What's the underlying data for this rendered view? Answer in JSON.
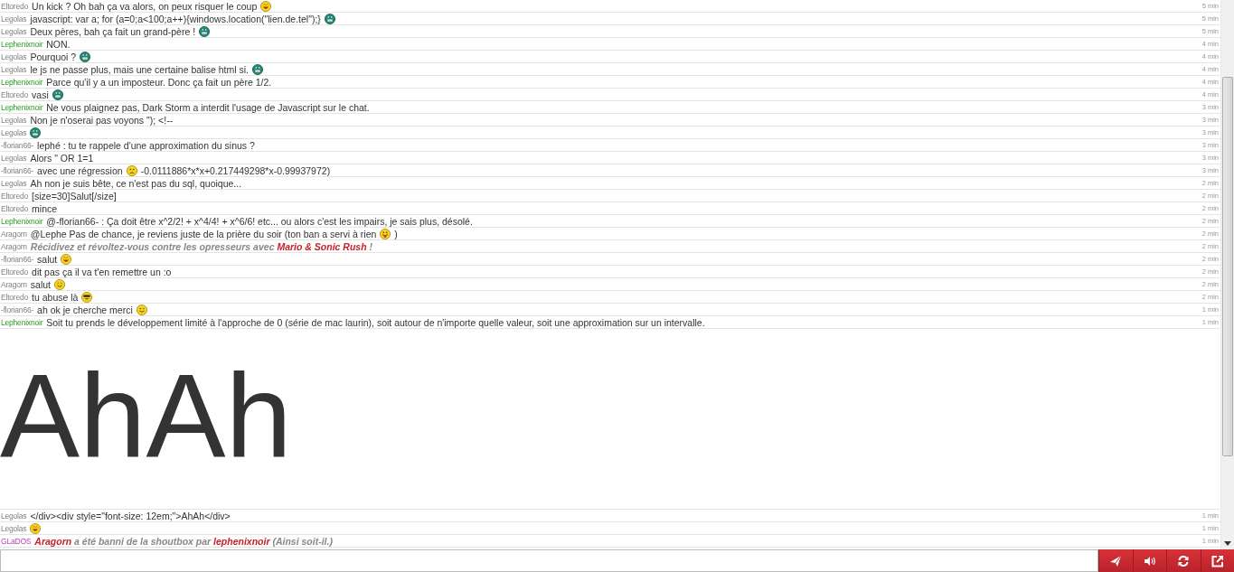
{
  "messages": [
    {
      "kind": "message",
      "author": {
        "name": "Eltoredo",
        "kind": "member"
      },
      "time": "5 min",
      "parts": [
        {
          "kind": "text",
          "text": "Un kick ? Oh bah ça va alors, on peux risquer le coup"
        },
        {
          "kind": "smiley",
          "icon": {
            "kind": "laugh"
          }
        }
      ]
    },
    {
      "kind": "message",
      "author": {
        "name": "Legolas",
        "kind": "member"
      },
      "time": "5 min",
      "parts": [
        {
          "kind": "text",
          "text": "javascript: var a; for (a=0;a<100;a++){windows.location(\"lien.de.tel\");}"
        },
        {
          "kind": "smiley",
          "icon": {
            "kind": "grin"
          }
        }
      ]
    },
    {
      "kind": "message",
      "author": {
        "name": "Legolas",
        "kind": "member"
      },
      "time": "5 min",
      "parts": [
        {
          "kind": "text",
          "text": "Deux pères, bah ça fait un grand-père !"
        },
        {
          "kind": "smiley",
          "icon": {
            "kind": "grin"
          }
        }
      ]
    },
    {
      "kind": "message",
      "author": {
        "name": "Lephenixnoir",
        "kind": "moderator"
      },
      "time": "4 min",
      "parts": [
        {
          "kind": "text",
          "text": "NON."
        }
      ]
    },
    {
      "kind": "message",
      "author": {
        "name": "Legolas",
        "kind": "member"
      },
      "time": "4 min",
      "parts": [
        {
          "kind": "text",
          "text": "Pourquoi ?"
        },
        {
          "kind": "smiley",
          "icon": {
            "kind": "grin"
          }
        }
      ]
    },
    {
      "kind": "message",
      "author": {
        "name": "Legolas",
        "kind": "member"
      },
      "time": "4 min",
      "parts": [
        {
          "kind": "text",
          "text": "le js ne passe plus, mais une certaine balise html si."
        },
        {
          "kind": "smiley",
          "icon": {
            "kind": "grin"
          }
        }
      ]
    },
    {
      "kind": "message",
      "author": {
        "name": "Lephenixnoir",
        "kind": "moderator"
      },
      "time": "4 min",
      "parts": [
        {
          "kind": "text",
          "text": "Parce qu'il y a un imposteur. Donc ça fait un père 1/2."
        }
      ]
    },
    {
      "kind": "message",
      "author": {
        "name": "Eltoredo",
        "kind": "member"
      },
      "time": "4 min",
      "parts": [
        {
          "kind": "text",
          "text": "vasi"
        },
        {
          "kind": "smiley",
          "icon": {
            "kind": "grin"
          }
        }
      ]
    },
    {
      "kind": "message",
      "author": {
        "name": "Lephenixnoir",
        "kind": "moderator"
      },
      "time": "3 min",
      "parts": [
        {
          "kind": "text",
          "text": "Ne vous plaignez pas, Dark Storm a interdit l'usage de Javascript sur le chat."
        }
      ]
    },
    {
      "kind": "message",
      "author": {
        "name": "Legolas",
        "kind": "member"
      },
      "time": "3 min",
      "parts": [
        {
          "kind": "text",
          "text": "Non je n'oserai pas voyons \"); <!--"
        }
      ]
    },
    {
      "kind": "message",
      "author": {
        "name": "Legolas",
        "kind": "member"
      },
      "time": "3 min",
      "parts": [
        {
          "kind": "smiley",
          "icon": {
            "kind": "grin"
          }
        }
      ]
    },
    {
      "kind": "message",
      "author": {
        "name": "-florian66-",
        "kind": "member"
      },
      "time": "3 min",
      "parts": [
        {
          "kind": "text",
          "text": "lephé : tu te rappele d'une approximation du sinus ?"
        }
      ]
    },
    {
      "kind": "message",
      "author": {
        "name": "Legolas",
        "kind": "member"
      },
      "time": "3 min",
      "parts": [
        {
          "kind": "text",
          "text": "Alors \" OR 1=1"
        }
      ]
    },
    {
      "kind": "message",
      "author": {
        "name": "-florian66-",
        "kind": "member"
      },
      "time": "3 min",
      "parts": [
        {
          "kind": "text",
          "text": "avec une régression"
        },
        {
          "kind": "smiley",
          "icon": {
            "kind": "sad"
          }
        },
        {
          "kind": "text",
          "text": "-0.0111886*x*x+0.217449298*x-0.99937972)"
        }
      ]
    },
    {
      "kind": "message",
      "author": {
        "name": "Legolas",
        "kind": "member"
      },
      "time": "2 min",
      "parts": [
        {
          "kind": "text",
          "text": "Ah non je suis bête, ce n'est pas du sql, quoique..."
        }
      ]
    },
    {
      "kind": "message",
      "author": {
        "name": "Eltoredo",
        "kind": "member"
      },
      "time": "2 min",
      "parts": [
        {
          "kind": "text",
          "text": "[size=30]Salut[/size]"
        }
      ]
    },
    {
      "kind": "message",
      "author": {
        "name": "Eltoredo",
        "kind": "member"
      },
      "time": "2 min",
      "parts": [
        {
          "kind": "text",
          "text": "mince"
        }
      ]
    },
    {
      "kind": "message",
      "author": {
        "name": "Lephenixnoir",
        "kind": "moderator"
      },
      "time": "2 min",
      "parts": [
        {
          "kind": "text",
          "text": "@-florian66- : Ça doit être x^2/2! + x^4/4! + x^6/6! etc... ou alors c'est les impairs, je sais plus, désolé."
        }
      ]
    },
    {
      "kind": "message",
      "author": {
        "name": "Aragorn",
        "kind": "member"
      },
      "time": "2 min",
      "parts": [
        {
          "kind": "text",
          "text": "@Lephe Pas de chance, je reviens juste de la prière du soir (ton ban a servi à rien"
        },
        {
          "kind": "smiley",
          "icon": {
            "kind": "tongue"
          }
        },
        {
          "kind": "text",
          "text": ")"
        }
      ]
    },
    {
      "kind": "message",
      "author": {
        "name": "Aragorn",
        "kind": "member"
      },
      "time": "2 min",
      "parts": [
        {
          "kind": "notice",
          "text": "Récidivez et révoltez-vous contre les opresseurs avec **Mario & Sonic Rush** !"
        }
      ]
    },
    {
      "kind": "message",
      "author": {
        "name": "-florian66-",
        "kind": "member"
      },
      "time": "2 min",
      "parts": [
        {
          "kind": "text",
          "text": "salut"
        },
        {
          "kind": "smiley",
          "icon": {
            "kind": "laugh"
          }
        }
      ]
    },
    {
      "kind": "message",
      "author": {
        "name": "Eltoredo",
        "kind": "member"
      },
      "time": "2 min",
      "parts": [
        {
          "kind": "text",
          "text": "dit pas ça il va t'en remettre un :o"
        }
      ]
    },
    {
      "kind": "message",
      "author": {
        "name": "Aragorn",
        "kind": "member"
      },
      "time": "2 min",
      "parts": [
        {
          "kind": "text",
          "text": "salut"
        },
        {
          "kind": "smiley",
          "icon": {
            "kind": "smile"
          }
        }
      ]
    },
    {
      "kind": "message",
      "author": {
        "name": "Eltoredo",
        "kind": "member"
      },
      "time": "2 min",
      "parts": [
        {
          "kind": "text",
          "text": "tu abuse là"
        },
        {
          "kind": "smiley",
          "icon": {
            "kind": "cool"
          }
        }
      ]
    },
    {
      "kind": "message",
      "author": {
        "name": "-florian66-",
        "kind": "member"
      },
      "time": "1 min",
      "parts": [
        {
          "kind": "text",
          "text": "ah ok je cherche merci"
        },
        {
          "kind": "smiley",
          "icon": {
            "kind": "wink"
          }
        }
      ]
    },
    {
      "kind": "message",
      "author": {
        "name": "Lephenixnoir",
        "kind": "moderator"
      },
      "time": "1 min",
      "parts": [
        {
          "kind": "text",
          "text": "Soit tu prends le développement limité à l'approche de 0 (série de mac laurin), soit autour de n'importe quelle valeur, soit une approximation sur un intervalle."
        }
      ]
    },
    {
      "kind": "big",
      "text": "AhAh"
    },
    {
      "kind": "message",
      "author": {
        "name": "Legolas",
        "kind": "member"
      },
      "time": "1 min",
      "parts": [
        {
          "kind": "text",
          "text": "</div><div style=\"font-size: 12em;\">AhAh</div>"
        }
      ]
    },
    {
      "kind": "message",
      "author": {
        "name": "Legolas",
        "kind": "member"
      },
      "time": "1 min",
      "parts": [
        {
          "kind": "smiley",
          "icon": {
            "kind": "laugh"
          }
        }
      ]
    },
    {
      "kind": "message",
      "author": {
        "name": "GLaDOS",
        "kind": "bot"
      },
      "time": "1 min",
      "parts": [
        {
          "kind": "notice",
          "text": "**Aragorn** a été banni de la shoutbox par **lephenixnoir** (Ainsi soit-il.)"
        }
      ]
    }
  ],
  "buttons": [
    {
      "kind": "send"
    },
    {
      "kind": "sound"
    },
    {
      "kind": "refresh"
    },
    {
      "kind": "popout"
    }
  ]
}
